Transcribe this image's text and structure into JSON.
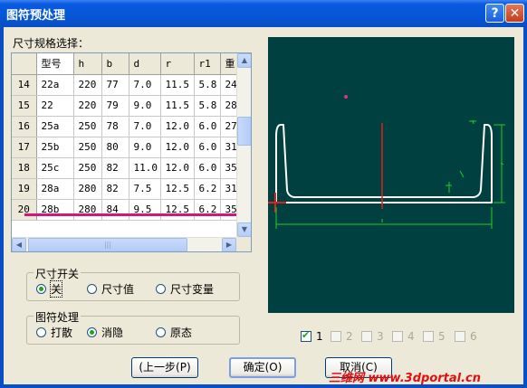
{
  "window": {
    "title": "图符预处理",
    "help_glyph": "?",
    "close_glyph": "✕"
  },
  "spec_label": "尺寸规格选择：",
  "table": {
    "columns": [
      "型号",
      "h",
      "b",
      "d",
      "r",
      "r1",
      "重"
    ],
    "rows": [
      {
        "num": "14",
        "cells": [
          "22a",
          "220",
          "77",
          "7.0",
          "11.5",
          "5.8",
          "24"
        ]
      },
      {
        "num": "15",
        "cells": [
          "22",
          "220",
          "79",
          "9.0",
          "11.5",
          "5.8",
          "28"
        ]
      },
      {
        "num": "16",
        "cells": [
          "25a",
          "250",
          "78",
          "7.0",
          "12.0",
          "6.0",
          "27"
        ]
      },
      {
        "num": "17",
        "cells": [
          "25b",
          "250",
          "80",
          "9.0",
          "12.0",
          "6.0",
          "31"
        ]
      },
      {
        "num": "18",
        "cells": [
          "25c",
          "250",
          "82",
          "11.0",
          "12.0",
          "6.0",
          "35"
        ]
      },
      {
        "num": "19",
        "cells": [
          "28a",
          "280",
          "82",
          "7.5",
          "12.5",
          "6.2",
          "31"
        ]
      },
      {
        "num": "20",
        "cells": [
          "28b",
          "280",
          "84",
          "9.5",
          "12.5",
          "6.2",
          "35"
        ]
      }
    ],
    "scroll_up": "▲",
    "scroll_down": "▼",
    "scroll_left": "◀",
    "scroll_right": "▶",
    "thumb_grip": "|||"
  },
  "dim_switch": {
    "legend": "尺寸开关",
    "options": [
      "关",
      "尺寸值",
      "尺寸变量"
    ],
    "selected": "关"
  },
  "symbol_process": {
    "legend": "图符处理",
    "options": [
      "打散",
      "消隐",
      "原态"
    ],
    "selected": "消隐"
  },
  "views": [
    {
      "label": "1",
      "checked": true,
      "enabled": true
    },
    {
      "label": "2",
      "checked": false,
      "enabled": false
    },
    {
      "label": "3",
      "checked": false,
      "enabled": false
    },
    {
      "label": "4",
      "checked": false,
      "enabled": false
    },
    {
      "label": "5",
      "checked": false,
      "enabled": false
    },
    {
      "label": "6",
      "checked": false,
      "enabled": false
    }
  ],
  "buttons": {
    "prev": "(上一步(P)",
    "ok": "确定(O)",
    "cancel": "取消(C)"
  },
  "watermark": "三维网 www.3dportal.cn",
  "colors": {
    "preview_bg": "#004040",
    "highlight": "#d4157a",
    "titlebar": "#0a5ae0"
  }
}
